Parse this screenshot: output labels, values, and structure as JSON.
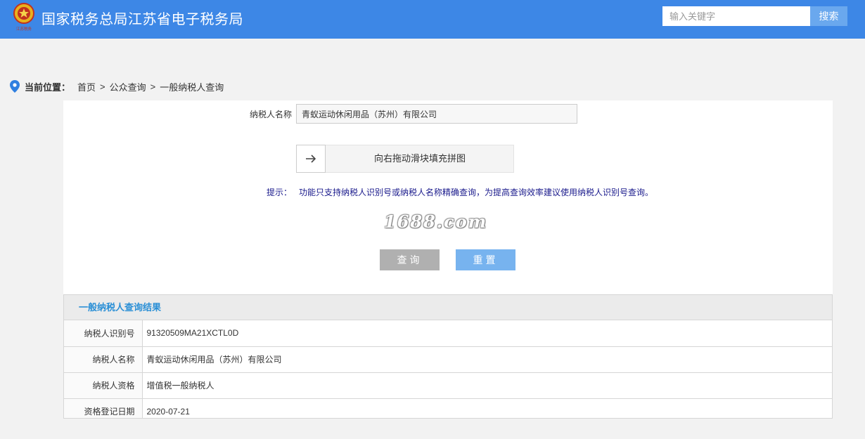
{
  "header": {
    "logo_text": "江苏税务",
    "title": "国家税务总局江苏省电子税务局",
    "search_placeholder": "输入关键字",
    "search_button": "搜索"
  },
  "breadcrumb": {
    "current_label": "当前位置：",
    "items": [
      "首页",
      "公众查询",
      "一般纳税人查询"
    ],
    "separator": ">"
  },
  "form": {
    "name_label": "纳税人名称",
    "name_value": "青蚁运动休闲用品（苏州）有限公司",
    "slider_text": "向右拖动滑块填充拼图",
    "tip_label": "提示：",
    "tip_text": "功能只支持纳税人识别号或纳税人名称精确查询，为提高查询效率建议使用纳税人识别号查询。",
    "watermark": "1688.com",
    "query_button": "查询",
    "reset_button": "重置"
  },
  "result": {
    "title": "一般纳税人查询结果",
    "rows": [
      {
        "label": "纳税人识别号",
        "value": "91320509MA21XCTL0D"
      },
      {
        "label": "纳税人名称",
        "value": "青蚁运动休闲用品（苏州）有限公司"
      },
      {
        "label": "纳税人资格",
        "value": "增值税一般纳税人"
      },
      {
        "label": "资格登记日期",
        "value": "2020-07-21"
      }
    ]
  },
  "colors": {
    "header_bg": "#3d87e6",
    "tip_text": "#1a1a8c",
    "result_title": "#2a8fd6",
    "query_button": "#b0b0b0",
    "reset_button": "#77b3ef"
  }
}
